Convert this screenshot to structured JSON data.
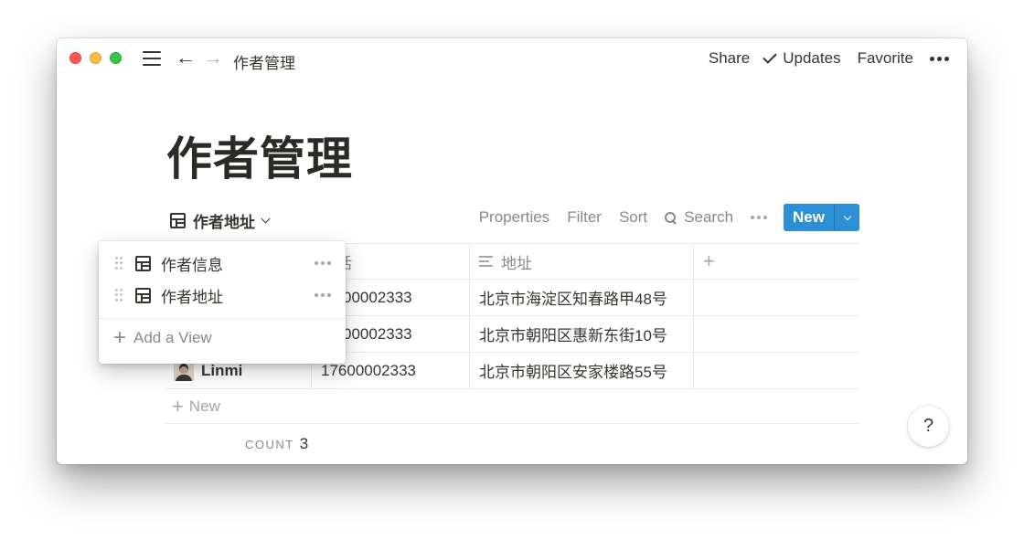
{
  "window": {
    "traffic_lights": [
      "close",
      "minimize",
      "zoom"
    ],
    "breadcrumb": "作者管理",
    "actions": {
      "share": "Share",
      "updates": "Updates",
      "favorite": "Favorite"
    }
  },
  "page": {
    "title": "作者管理"
  },
  "view_bar": {
    "current_view": "作者地址",
    "tools": {
      "properties": "Properties",
      "filter": "Filter",
      "sort": "Sort",
      "search": "Search"
    },
    "new_button": "New"
  },
  "table": {
    "columns": [
      {
        "label": "",
        "icon": "title-icon"
      },
      {
        "label": "电话",
        "icon": "phone-icon"
      },
      {
        "label": "地址",
        "icon": "text-icon"
      },
      {
        "label": "+",
        "icon": "add-column-icon"
      }
    ],
    "rows": [
      {
        "name": "",
        "phone": "00002333",
        "address": "北京市海淀区知春路甲48号"
      },
      {
        "name": "",
        "phone": "00002333",
        "address": "北京市朝阳区惠新东街10号"
      },
      {
        "name": "Linmi",
        "phone": "17600002333",
        "address": "北京市朝阳区安家楼路55号"
      }
    ],
    "new_row_label": "New",
    "count_label": "COUNT",
    "count_value": "3"
  },
  "view_dropdown": {
    "items": [
      {
        "label": "作者信息",
        "icon": "table-icon"
      },
      {
        "label": "作者地址",
        "icon": "table-icon"
      }
    ],
    "add_view_label": "Add a View"
  },
  "help_button": "?",
  "colors": {
    "accent": "#2d8fd5",
    "text": "#37352f",
    "muted": "#8a8986",
    "border": "#e9e9e7"
  }
}
